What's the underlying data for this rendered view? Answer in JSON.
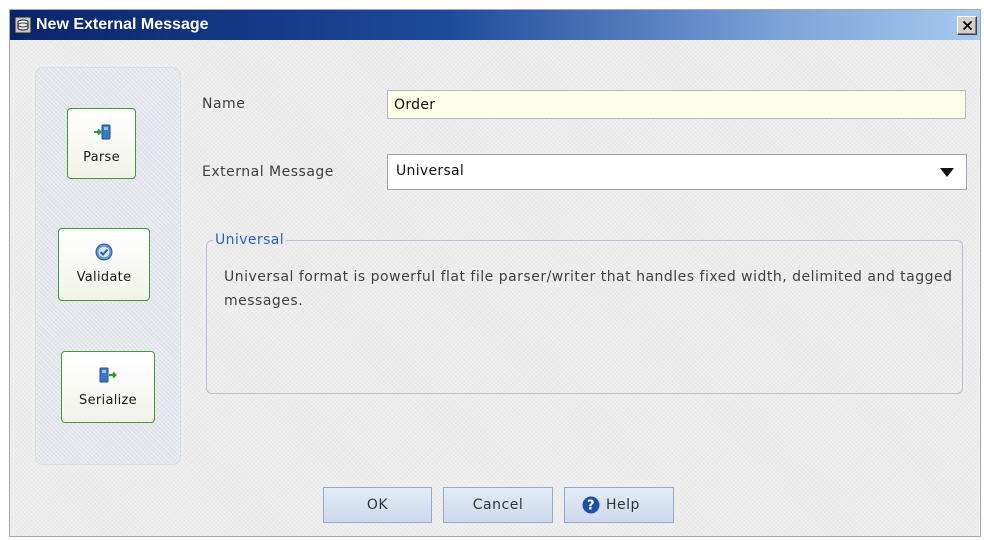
{
  "window": {
    "title": "New External Message",
    "close_glyph": "✕",
    "icon": "document-db-icon"
  },
  "actions": [
    {
      "label": "Parse",
      "icon": "parse-arrow-icon"
    },
    {
      "label": "Validate",
      "icon": "check-circle-icon"
    },
    {
      "label": "Serialize",
      "icon": "serialize-arrow-icon"
    }
  ],
  "form": {
    "name_label": "Name",
    "name_value": "Order",
    "external_label": "External Message",
    "external_value": "Universal"
  },
  "description": {
    "title": "Universal",
    "text": "Universal format is powerful flat file parser/writer that handles fixed width, delimited and tagged messages."
  },
  "buttons": {
    "ok": "OK",
    "cancel": "Cancel",
    "help": "Help"
  },
  "colors": {
    "title_bar_start": "#0a246a",
    "title_bar_end": "#a6caf0",
    "action_border": "#3f9a2f",
    "group_title": "#2b5fbd",
    "name_field_bg": "#fffee8"
  }
}
